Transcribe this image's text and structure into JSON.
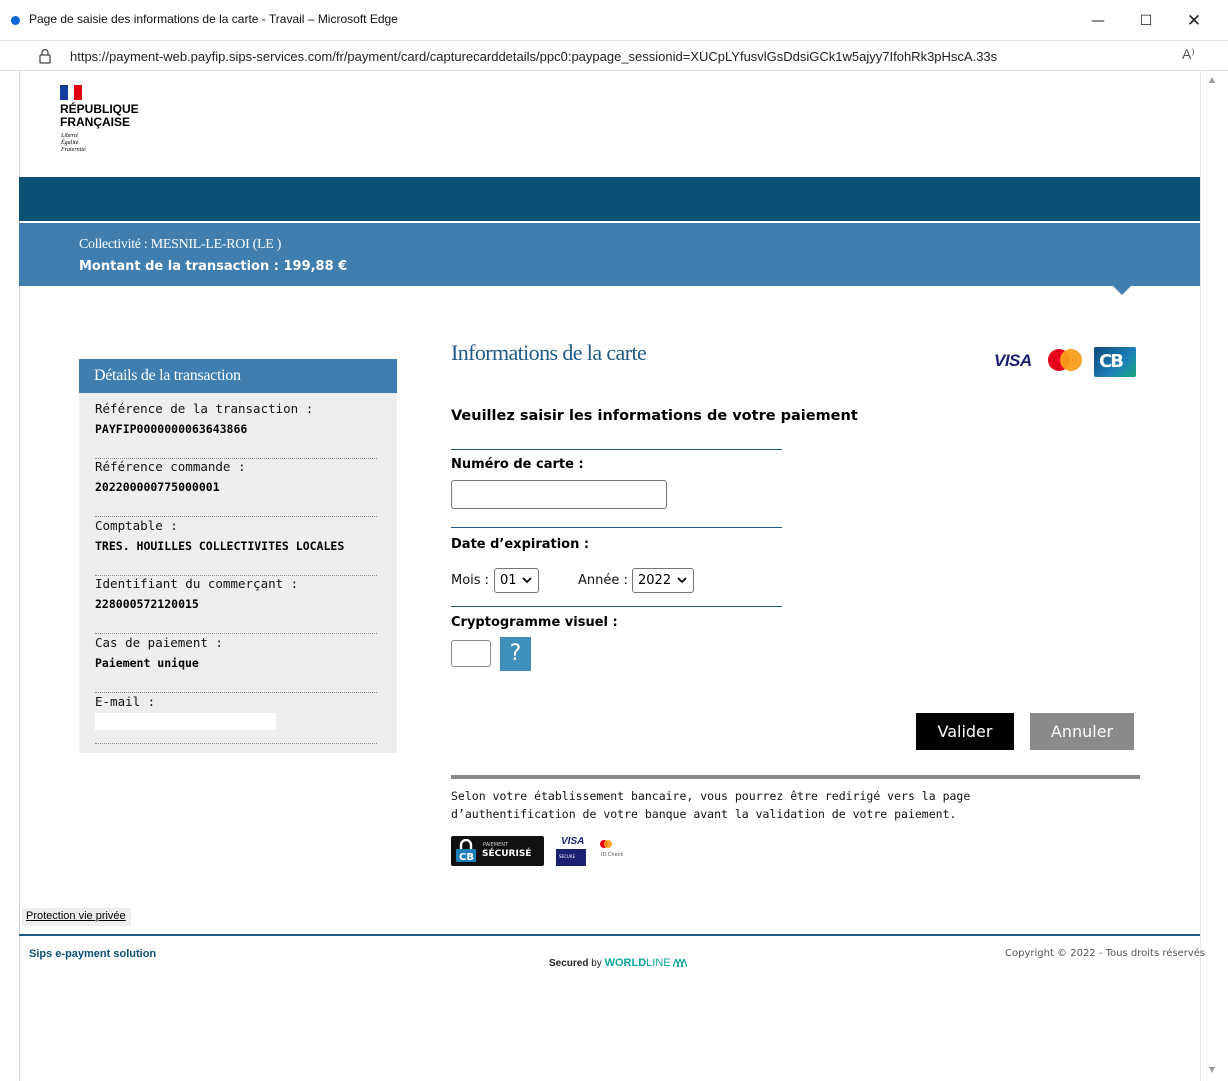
{
  "window": {
    "title": "Page de saisie des informations de la carte - Travail – Microsoft Edge",
    "minimize": "—",
    "maximize": "☐",
    "close": "✕"
  },
  "address_bar": {
    "url": "https://payment-web.payfip.sips-services.com/fr/payment/card/capturecarddetails/ppc0:paypage_sessionid=XUCpLYfusvlGsDdsiGCk1w5ajyy7IfohRk3pHscA.33s",
    "read_aloud": "A⁾"
  },
  "logo": {
    "name_line1": "RÉPUBLIQUE",
    "name_line2": "FRANÇAISE",
    "motto1": "Liberté",
    "motto2": "Égalité",
    "motto3": "Fraternité"
  },
  "banner": {
    "collectivite": "Collectivité : MESNIL-LE-ROI (LE )",
    "amount": "Montant de la transaction  :  199,88 €"
  },
  "details": {
    "title": "Détails de la transaction",
    "items": [
      {
        "label": "Référence de la transaction :",
        "value": "PAYFIP0000000063643866"
      },
      {
        "label": "Référence commande :",
        "value": "202200000775000001"
      },
      {
        "label": "Comptable :",
        "value": "TRES. HOUILLES COLLECTIVITES LOCALES"
      },
      {
        "label": "Identifiant du commerçant :",
        "value": "228000572120015"
      },
      {
        "label": "Cas de paiement :",
        "value": "Paiement unique"
      },
      {
        "label": "E-mail :",
        "value": ""
      }
    ]
  },
  "form": {
    "title": "Informations de la carte",
    "prompt": "Veuillez saisir les informations de votre paiement",
    "card_number_label": "Numéro de carte :",
    "card_number_value": "",
    "expiry_label": "Date d’expiration :",
    "month_label": "Mois :",
    "month_value": "01",
    "year_label": "Année :",
    "year_value": "2022",
    "cvv_label": "Cryptogramme visuel :",
    "cvv_value": "",
    "help_label": "?",
    "submit": "Valider",
    "cancel": "Annuler",
    "notice": "Selon votre établissement bancaire, vous pourrez être redirigé vers la page d’authentification de votre banque avant la validation de votre paiement."
  },
  "brand_logos": {
    "visa": "VISA",
    "cb": "CB"
  },
  "secure_badges": {
    "cb_small": "PAIEMENT",
    "cb_big": "SÉCURISÉ",
    "visa_top": "VISA",
    "visa_bottom": "SECURE",
    "mc_text": "ID Check"
  },
  "footer": {
    "privacy": "Protection vie privée",
    "left": "Sips e-payment solution",
    "secured_prefix": "Secured",
    "secured_by": "by",
    "brand_bold": "WORLD",
    "brand_light": "LINE",
    "copyright": "Copyright © 2022 - Tous droits réservés"
  },
  "colors": {
    "dark_band": "#0c5074",
    "light_band": "#3f7eaf",
    "title_blue": "#1f5a86"
  }
}
